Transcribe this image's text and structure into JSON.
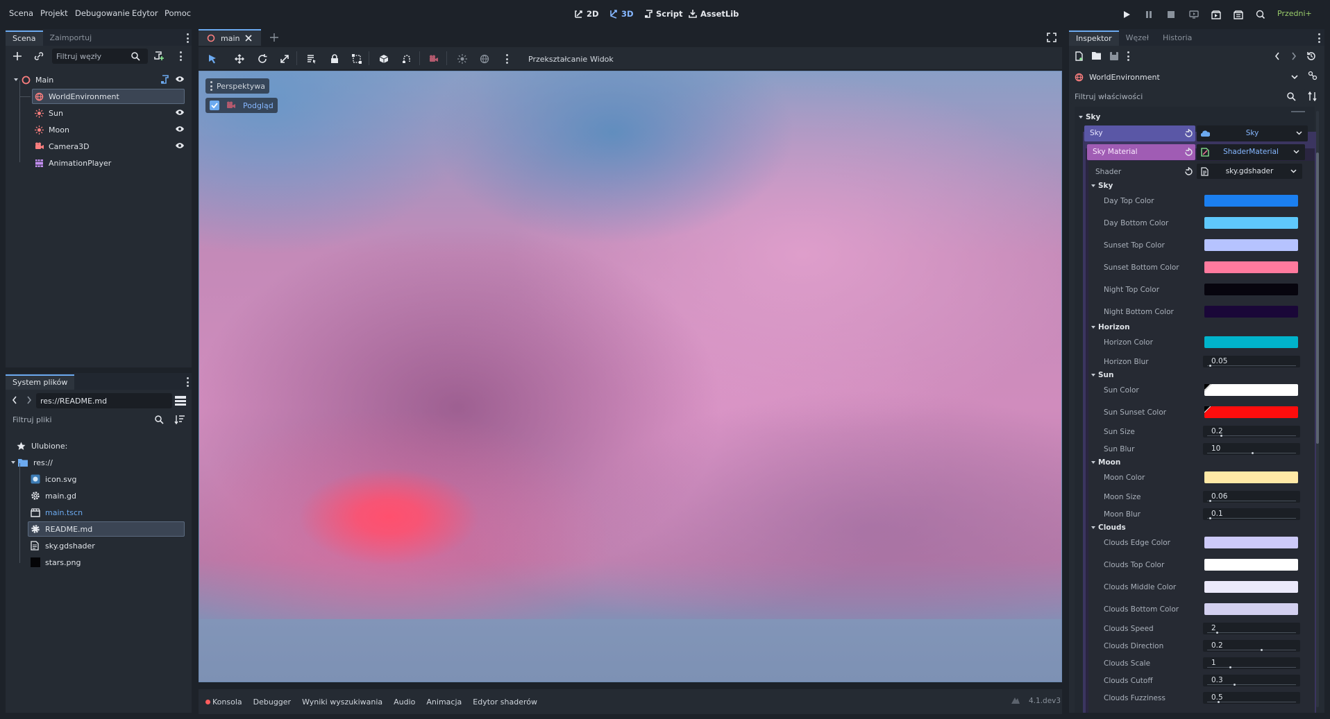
{
  "menu": [
    "Scena",
    "Projekt",
    "Debugowanie",
    "Edytor",
    "Pomoc"
  ],
  "workspaces": [
    {
      "label": "2D",
      "icon": "2d-icon",
      "active": false
    },
    {
      "label": "3D",
      "icon": "3d-icon",
      "active": true
    },
    {
      "label": "Script",
      "icon": "script-icon",
      "active": false
    },
    {
      "label": "AssetLib",
      "icon": "assetlib-icon",
      "active": false
    }
  ],
  "renderer": "Przedni+",
  "scene_dock": {
    "tabs": [
      "Scena",
      "Zaimportuj"
    ],
    "filter_placeholder": "Filtruj węzły",
    "nodes": [
      {
        "label": "Main",
        "icon": "node3d-icon",
        "color": "#fc7f7f"
      },
      {
        "label": "WorldEnvironment",
        "icon": "world-environment-icon",
        "color": "#fc7f7f"
      },
      {
        "label": "Sun",
        "icon": "directional-light-icon",
        "color": "#fc7f7f"
      },
      {
        "label": "Moon",
        "icon": "directional-light-icon",
        "color": "#fc7f7f"
      },
      {
        "label": "Camera3D",
        "icon": "camera3d-icon",
        "color": "#fc7f7f"
      },
      {
        "label": "AnimationPlayer",
        "icon": "animation-player-icon",
        "color": "#c38ef1"
      }
    ]
  },
  "filesystem_dock": {
    "tab": "System plików",
    "path": "res://README.md",
    "filter_placeholder": "Filtruj pliki",
    "favorites": "Ulubione:",
    "root": "res://",
    "files": [
      {
        "label": "icon.svg",
        "icon": "image-icon"
      },
      {
        "label": "main.gd",
        "icon": "gear-icon"
      },
      {
        "label": "main.tscn",
        "icon": "scene-icon"
      },
      {
        "label": "README.md",
        "icon": "text-file-icon"
      },
      {
        "label": "sky.gdshader",
        "icon": "shader-file-icon"
      },
      {
        "label": "stars.png",
        "icon": "image-icon"
      }
    ]
  },
  "editor_tabs": {
    "tab": "main"
  },
  "viewport_toolbar": {
    "transform_menu": "Przekształcanie",
    "view_menu": "Widok"
  },
  "viewport": {
    "perspective": "Perspektywa",
    "preview": "Podgląd"
  },
  "bottom_panel": {
    "tabs": [
      "Konsola",
      "Debugger",
      "Wyniki wyszukiwania",
      "Audio",
      "Animacja",
      "Edytor shaderów"
    ],
    "version": "4.1.dev3"
  },
  "inspector": {
    "tabs": [
      "Inspektor",
      "Węzeł",
      "Historia"
    ],
    "object": "WorldEnvironment",
    "filter_placeholder": "Filtruj właściwości",
    "category_sky": "Sky",
    "sky_label": "Sky",
    "sky_value": "Sky",
    "sky_material_label": "Sky Material",
    "sky_material_value": "ShaderMaterial",
    "shader_label": "Shader",
    "shader_value": "sky.gdshader",
    "groups": {
      "sky": "Sky",
      "horizon": "Horizon",
      "sun": "Sun",
      "moon": "Moon",
      "clouds": "Clouds"
    },
    "props": {
      "day_top_color": {
        "label": "Day Top Color",
        "color": "#1b7ff0"
      },
      "day_bottom_color": {
        "label": "Day Bottom Color",
        "color": "#5fc8fb"
      },
      "sunset_top_color": {
        "label": "Sunset Top Color",
        "color": "#b6c3ff"
      },
      "sunset_bottom_color": {
        "label": "Sunset Bottom Color",
        "color": "#ff7a9e"
      },
      "night_top_color": {
        "label": "Night Top Color",
        "color": "#07050e"
      },
      "night_bottom_color": {
        "label": "Night Bottom Color",
        "color": "#1a0738"
      },
      "horizon_color": {
        "label": "Horizon Color",
        "color": "#00b3cb"
      },
      "horizon_blur": {
        "label": "Horizon Blur",
        "value": "0.05",
        "fill": 0.02
      },
      "sun_color": {
        "label": "Sun Color",
        "color": "#ffffff"
      },
      "sun_sunset_color": {
        "label": "Sun Sunset Color",
        "color": "#ff0d0d"
      },
      "sun_size": {
        "label": "Sun Size",
        "value": "0.2",
        "fill": 0.15
      },
      "sun_blur": {
        "label": "Sun Blur",
        "value": "10",
        "fill": 0.5
      },
      "moon_color": {
        "label": "Moon Color",
        "color": "#ffe9a6"
      },
      "moon_size": {
        "label": "Moon Size",
        "value": "0.06",
        "fill": 0.02
      },
      "moon_blur": {
        "label": "Moon Blur",
        "value": "0.1",
        "fill": 0.02
      },
      "clouds_edge_color": {
        "label": "Clouds Edge Color",
        "color": "#cdcaf9"
      },
      "clouds_top_color": {
        "label": "Clouds Top Color",
        "color": "#ffffff"
      },
      "clouds_middle_color": {
        "label": "Clouds Middle Color",
        "color": "#ebe9fb"
      },
      "clouds_bottom_color": {
        "label": "Clouds Bottom Color",
        "color": "#d3d0f0"
      },
      "clouds_speed": {
        "label": "Clouds Speed",
        "value": "2",
        "fill": 0.1
      },
      "clouds_direction": {
        "label": "Clouds Direction",
        "value": "0.2",
        "fill": 0.6
      },
      "clouds_scale": {
        "label": "Clouds Scale",
        "value": "1",
        "fill": 0.25
      },
      "clouds_cutoff": {
        "label": "Clouds Cutoff",
        "value": "0.3",
        "fill": 0.3
      },
      "clouds_fuzziness": {
        "label": "Clouds Fuzziness",
        "value": "0.5",
        "fill": 0.12
      }
    }
  }
}
